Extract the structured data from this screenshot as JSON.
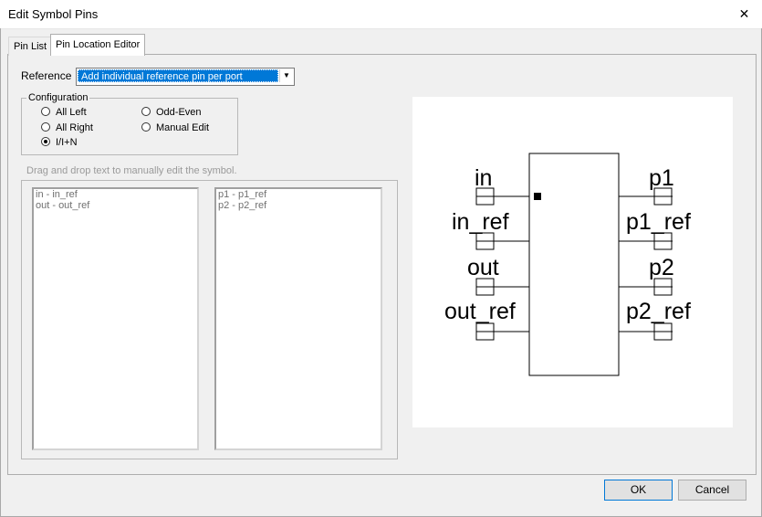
{
  "window": {
    "title": "Edit Symbol Pins",
    "close_glyph": "✕"
  },
  "tabs": [
    {
      "label": "Pin List"
    },
    {
      "label": "Pin Location Editor"
    }
  ],
  "reference": {
    "label": "Reference",
    "value": "Add individual reference pin per port"
  },
  "configuration": {
    "legend": "Configuration",
    "options": [
      {
        "label": "All Left",
        "selected": false
      },
      {
        "label": "All Right",
        "selected": false
      },
      {
        "label": "I/I+N",
        "selected": true
      },
      {
        "label": "Odd-Even",
        "selected": false
      },
      {
        "label": "Manual Edit",
        "selected": false
      }
    ]
  },
  "drag": {
    "hint": "Drag and drop text to manually edit the symbol.",
    "left_items": [
      "in - in_ref",
      "out - out_ref"
    ],
    "right_items": [
      "p1 - p1_ref",
      "p2 - p2_ref"
    ]
  },
  "symbol": {
    "left_pins": [
      "in",
      "in_ref",
      "out",
      "out_ref"
    ],
    "right_pins": [
      "p1",
      "p1_ref",
      "p2",
      "p2_ref"
    ]
  },
  "buttons": {
    "ok": "OK",
    "cancel": "Cancel"
  }
}
